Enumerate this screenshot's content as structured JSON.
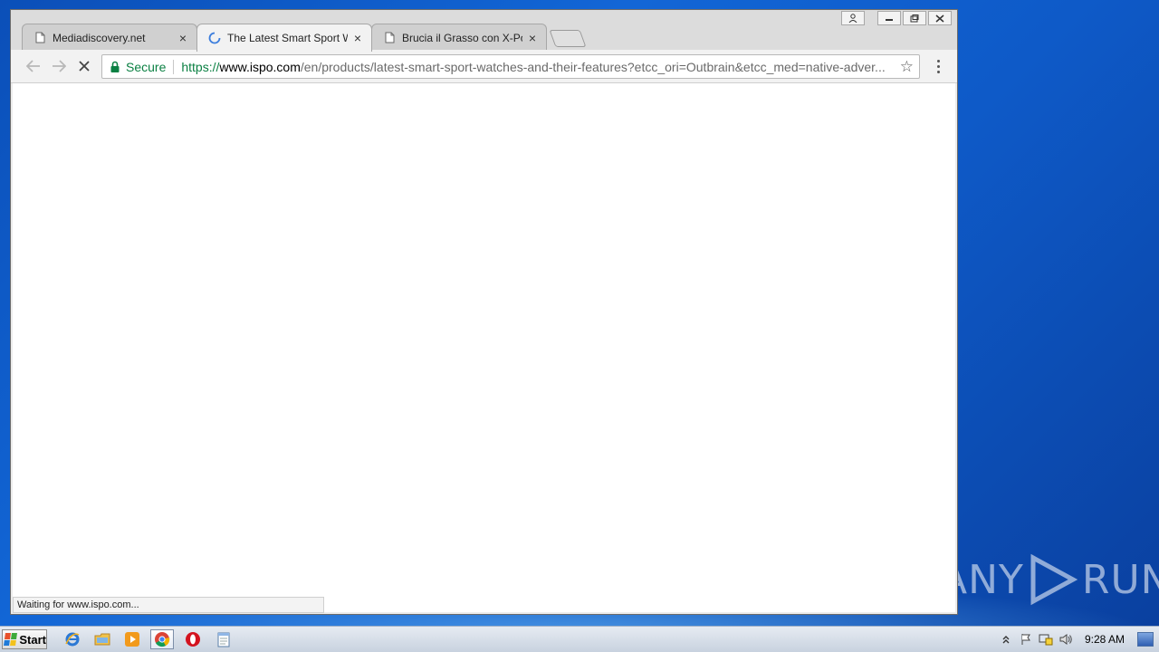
{
  "browser": {
    "tabs": [
      {
        "title": "Mediadiscovery.net",
        "icon": "page-icon",
        "active": false
      },
      {
        "title": "The Latest Smart Sport Wat",
        "icon": "loading-spinner-icon",
        "active": true
      },
      {
        "title": "Brucia il Grasso con X-Power",
        "icon": "page-icon",
        "active": false
      }
    ],
    "close_glyph": "×",
    "address": {
      "secure_label": "Secure",
      "url_scheme": "https://",
      "url_host": "www.ispo.com",
      "url_path": "/en/products/latest-smart-sport-watches-and-their-features?etcc_ori=Outbrain&etcc_med=native-adver..."
    },
    "status_text": "Waiting for www.ispo.com..."
  },
  "taskbar": {
    "start_label": "Start",
    "apps": [
      "internet-explorer-icon",
      "file-explorer-icon",
      "media-player-icon",
      "chrome-icon",
      "opera-icon",
      "notepad-icon"
    ],
    "clock": "9:28 AM"
  },
  "watermark": {
    "left": "ANY",
    "right": "RUN"
  },
  "colors": {
    "secure_green": "#0b8043",
    "desktop_blue": "#1266d6"
  }
}
